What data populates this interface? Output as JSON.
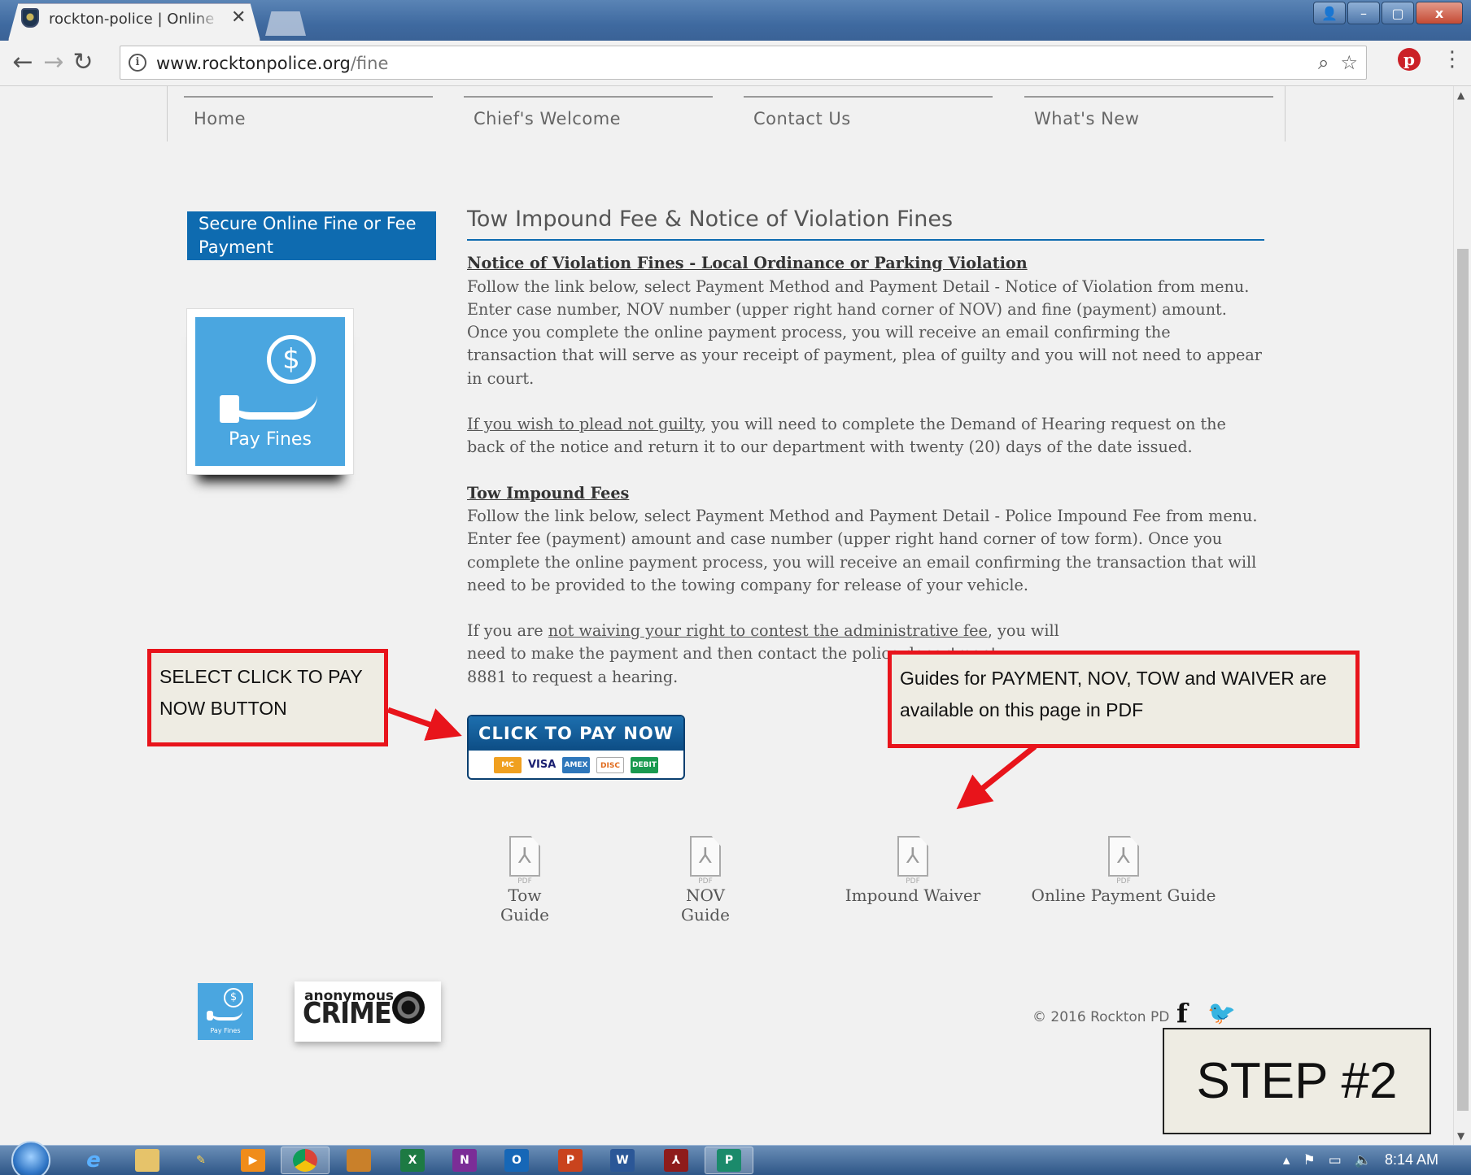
{
  "browser": {
    "tab_title": "rockton-police | Online Fine",
    "tab_close": "✕",
    "url_domain": "www.rocktonpolice.org",
    "url_path": "/fine",
    "window_controls": {
      "minimize": "–",
      "maximize": "▢",
      "close": "x",
      "user": "👤"
    }
  },
  "site_nav": {
    "items": [
      {
        "label": "Home"
      },
      {
        "label": "Chief's Welcome"
      },
      {
        "label": "Contact Us"
      },
      {
        "label": "What's New"
      }
    ]
  },
  "sidebar": {
    "banner": "Secure Online Fine or Fee Payment",
    "pay_fines_label": "Pay Fines",
    "coin_symbol": "$"
  },
  "main": {
    "title": "Tow Impound Fee & Notice of Violation Fines",
    "nov_heading": "Notice of Violation Fines - Local Ordinance or Parking Violation",
    "nov_text": "Follow the link below, select Payment Method and Payment Detail - Notice of Violation from menu.  Enter case number, NOV number (upper right hand corner of NOV) and fine (payment) amount.  Once you complete the online payment process, you will receive an email confirming the transaction that will serve as your receipt of payment, plea of guilty and you will not need to appear in court.",
    "not_guilty_link": "If you wish to plead not guilty",
    "not_guilty_text": ", you will need to complete the Demand of Hearing request on the back of the notice and return it to our department with twenty (20) days of the date issued.",
    "tow_heading": "Tow Impound Fees",
    "tow_text": "Follow the link below, select Payment Method and Payment Detail - Police Impound Fee from menu.   Enter fee (payment) amount and case number (upper right hand corner of tow form).  Once you complete the online payment process, you will receive an email confirming the transaction that will need to be provided to the towing company for release of your vehicle.",
    "contest_prefix": "If you are ",
    "contest_link": "not waiving your right to contest the administrative fee",
    "contest_text": ", you will need to make the payment and then contact the police department",
    "contest_tail": "8881 to request a hearing.",
    "pay_button": "CLICK TO PAY NOW",
    "cards": [
      "MC",
      "VISA",
      "AMEX",
      "DISC",
      "DEBIT"
    ]
  },
  "guides": [
    {
      "label": "Tow Guide",
      "tag": "PDF"
    },
    {
      "label": "NOV Guide",
      "tag": "PDF"
    },
    {
      "label": "Impound Waiver",
      "tag": "PDF"
    },
    {
      "label": "Online Payment Guide",
      "tag": "PDF"
    }
  ],
  "footer": {
    "pay_fines_label": "Pay Fines",
    "crime_small": "anonymous",
    "crime_big": "CRIME",
    "copyright": "© 2016 Rockton PD",
    "facebook": "f",
    "twitter": "🐦"
  },
  "annotations": {
    "callout_pay": "SELECT CLICK TO PAY NOW BUTTON",
    "callout_guides": "Guides for PAYMENT,  NOV, TOW and WAIVER are available on this page in PDF",
    "step": "STEP #2"
  },
  "taskbar": {
    "clock": "8:14 AM"
  },
  "colors": {
    "accent_blue": "#0e6bb0",
    "callout_red": "#e8141b",
    "pay_tile": "#4aa6e0"
  }
}
